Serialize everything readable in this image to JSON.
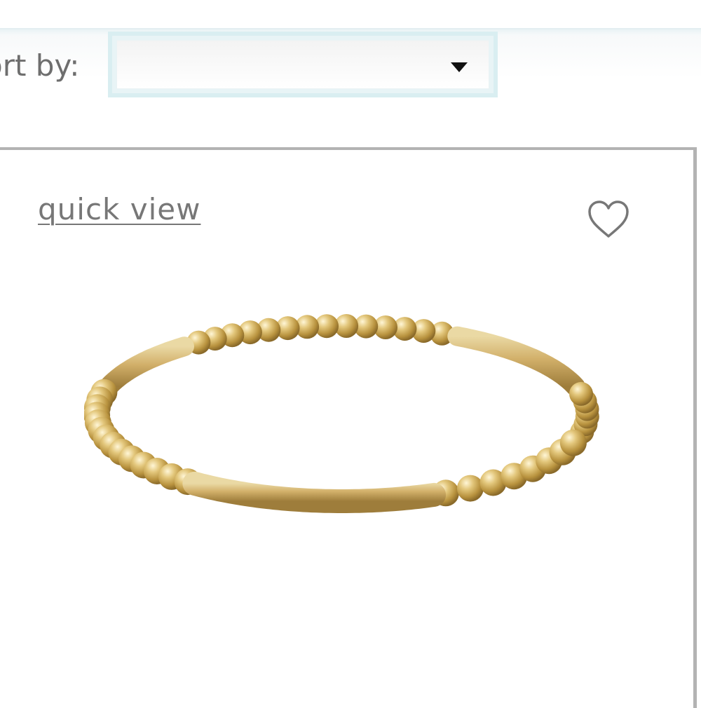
{
  "sort": {
    "label": "ort by:",
    "selected_value": "",
    "icon": "chevron-down-icon"
  },
  "product": {
    "quick_view_label": "quick view",
    "wishlist_icon": "heart-icon",
    "image": "gold beaded bar bangle bracelet",
    "accent_color": "#c9a959"
  }
}
